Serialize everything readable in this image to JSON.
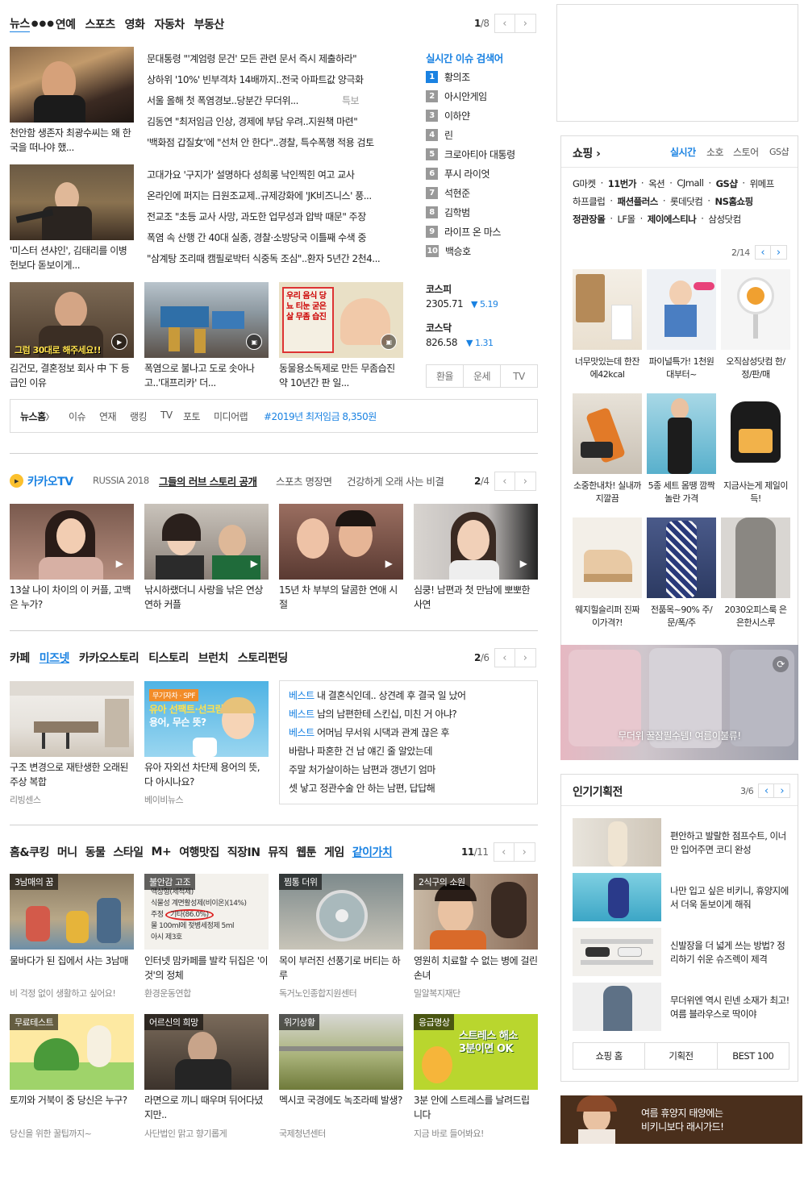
{
  "news": {
    "tabs": [
      "뉴스",
      "연예",
      "스포츠",
      "영화",
      "자동차",
      "부동산"
    ],
    "page": "1",
    "total": "/8",
    "photo_captions": [
      "천안함 생존자 최광수씨는 왜 한국을 떠나야 했...",
      "'미스터 션샤인', 김태리를 이병헌보다 돋보이게..."
    ],
    "headlines_1": [
      "문대통령 \"'계엄령 문건' 모든 관련 문서 즉시 제출하라\"",
      "상하위 '10%' 빈부격차 14배까지..전국 아파트값 양극화",
      "서울 올해 첫 폭염경보..당분간 무더위...",
      "김동연 \"최저임금 인상, 경제에 부담 우려..지원책 마련\"",
      "'백화점 갑질女'에 \"선처 안 한다\"..경찰, 특수폭행 적용 검토"
    ],
    "headline_tag": "특보",
    "headlines_2": [
      "고대가요 '구지가' 설명하다 성희롱 낙인찍힌 여고 교사",
      "온라인에 퍼지는 日원조교제..규제강화에 'JK비즈니스' 풍...",
      "전교조 \"초등 교사 사망, 과도한 업무성과 압박 때문\" 주장",
      "폭염 속 산행 간 40대 실종, 경찰·소방당국 이틀째 수색 중",
      "\"삼계탕 조리때 캠필로박터 식중독 조심\"..환자 5년간 2천4..."
    ],
    "bottom_captions": [
      "김건모, 결혼정보 회사 中 下 등급인 이유",
      "폭염으로 불나고 도로 솟아나고..'대프리카' 더...",
      "동물용소독제로 만든 무좀습진약 10년간 판 일..."
    ],
    "thumb_overlay": "그럼 30대로 해주세요!!",
    "sign_text": "우리 음식 당뇨 티눈 굳은살 무좀 습진",
    "realtime_title": "실시간 이슈 검색어",
    "realtime": [
      "황의조",
      "아시안게임",
      "이하얀",
      "린",
      "크로아티아 대통령",
      "푸시 라이엇",
      "석현준",
      "김학범",
      "라이프 온 마스",
      "백승호"
    ],
    "market": [
      {
        "name": "코스피",
        "value": "2305.71",
        "change": "▼ 5.19"
      },
      {
        "name": "코스닥",
        "value": "826.58",
        "change": "▼ 1.31"
      }
    ],
    "util_buttons": [
      "환율",
      "운세",
      "TV"
    ],
    "links": [
      "뉴스홈",
      "이슈",
      "연재",
      "랭킹",
      "TV",
      "포토",
      "미디어랩"
    ],
    "links_arrow": "〉",
    "hashtag": "#2019년 최저임금 8,350원"
  },
  "kakaotv": {
    "logo": "카카오TV",
    "tabs": [
      "RUSSIA 2018",
      "그들의 러브 스토리 공개",
      "스포츠 명장면",
      "건강하게 오래 사는 비결"
    ],
    "page": "2",
    "total": "/4",
    "captions": [
      "13살 나이 차이의 이 커플, 고백은 누가?",
      "낚시하랬더니 사랑을 낚은 연상연하 커플",
      "15년 차 부부의 달콤한 연애 시절",
      "심쿵! 남편과 첫 만남에 뽀뽀한 사연"
    ]
  },
  "cafe": {
    "tabs": [
      "카페",
      "미즈넷",
      "카카오스토리",
      "티스토리",
      "브런치",
      "스토리펀딩"
    ],
    "page": "2",
    "total": "/6",
    "cards": [
      {
        "caption": "구조 변경으로 재탄생한 오래된 주상 복합",
        "source": "리빙센스"
      },
      {
        "caption": "유아 자외선 차단제 용어의 뜻, 다 아시나요?",
        "source": "베이비뉴스"
      }
    ],
    "promo_text": [
      "무기자차 · SPF",
      "유아 선팩트·선크림",
      "용어, 무슨 뜻?"
    ],
    "best_label": "베스트",
    "posts": [
      "내 결혼식인데.. 상견례 후 결국 일 났어",
      "남의 남편한테 스킨십, 미친 거 아냐?",
      "어머님 무서워 시댁과 관계 끊은 후",
      "바람나 파혼한 건 남 얘긴 줄 알았는데",
      "주말 처가살이하는 남편과 갱년기 엄마",
      "셋 낳고 정관수술 안 하는 남편, 답답해"
    ]
  },
  "home": {
    "tabs": [
      "홈&쿠킹",
      "머니",
      "동물",
      "스타일",
      "M+",
      "여행맛집",
      "직장IN",
      "뮤직",
      "웹툰",
      "게임",
      "같이가치"
    ],
    "page": "11",
    "total": "/11",
    "cards": [
      {
        "badge": "3남매의 꿈",
        "caption": "물바다가 된 집에서 사는 3남매",
        "source": "비 걱정 없이 생활하고 싶어요!"
      },
      {
        "badge": "불안감 고조",
        "caption": "인터넷 맘카페를 발칵 뒤집은 '이것'의 정체",
        "source": "환경운동연합"
      },
      {
        "badge": "찜통 더위",
        "caption": "목이 부러진 선풍기로 버티는 하루",
        "source": "독거노인종합지원센터"
      },
      {
        "badge": "2식구의 소원",
        "caption": "영원히 치료할 수 없는 병에 걸린 손녀",
        "source": "밀알복지재단"
      },
      {
        "badge": "무료테스트",
        "caption": "토끼와 거북이 중 당신은 누구?",
        "source": "당신을 위한 꿀팁까지~"
      },
      {
        "badge": "어르신의 희망",
        "caption": "라면으로 끼니 때우며 뒤어다녔지만..",
        "source": "사단법인 맑고 향기롭게"
      },
      {
        "badge": "위기상황",
        "caption": "멕시코 국경에도 녹조라떼 발생?",
        "source": "국제청년센터"
      },
      {
        "badge": "응급명상",
        "caption": "3분 안에 스트레스를 날려드립니다",
        "source": "지금 바로 들어봐요!"
      }
    ],
    "label_text": [
      "액상형(세척제)",
      "식물성 계면활성제(비이온)(14%)",
      "주정",
      "기타(86.0%)",
      "물 100ml에 젖병세정제 5ml",
      "아시 제3호"
    ],
    "stress_text": [
      "스트레스 해소",
      "3분이면 OK"
    ]
  },
  "shopping": {
    "title": "쇼핑",
    "title_arrow": "›",
    "tabs": [
      "실시간",
      "소호",
      "스토어",
      "GS샵"
    ],
    "malls_1": [
      "G마켓",
      "11번가",
      "옥션",
      "CJmall",
      "GS샵",
      "위메프"
    ],
    "malls_2": [
      "하프클럽",
      "패션플러스",
      "롯데닷컴",
      "NS홈쇼핑"
    ],
    "malls_3": [
      "정관장몰",
      "LF몰",
      "제이에스티나",
      "삼성닷컴"
    ],
    "page": "2",
    "total": "/14",
    "items": [
      "너무맛있는데 한잔에42kcal",
      "파이널특가! 1천원대부터~",
      "오직삼성닷컴 한/정/판/매",
      "소중한내차! 실내까지깔끔",
      "5종 세트 몸땡 깜짝놀란 가격",
      "지금사는게 제일이득!",
      "웨지힐슬리퍼 진짜 이가격?!",
      "전품목~90% 주/문/폭/주",
      "2030오피스룩 은은한시스루"
    ],
    "banner": "무더위 꿀잠필수템! 여름이불류!"
  },
  "events": {
    "title": "인기기획전",
    "page": "3",
    "total": "/6",
    "items": [
      "편안하고 발랄한 점프수트, 이너만 입어주면 코디 완성",
      "나만 입고 싶은 비키니, 휴양지에서 더욱 돋보이게 해줘",
      "신발장을 더 넓게 쓰는 방법? 정리하기 쉬운 슈즈렉이 제격",
      "무더위엔 역시 린넨 소재가 최고! 여름 블라우스로 딱이야"
    ],
    "buttons": [
      "쇼핑 홈",
      "기획전",
      "BEST 100"
    ]
  },
  "ad_banner": [
    "여름 휴양지 태양에는",
    "비키니보다 래시가드!"
  ],
  "colors": {
    "accent": "#1a82e2",
    "kakao": "#fbc02d",
    "brand_brown": "#4a2f1c"
  },
  "icons": {
    "prev": "‹",
    "next": "›",
    "play": "▶",
    "refresh": "⟳"
  }
}
